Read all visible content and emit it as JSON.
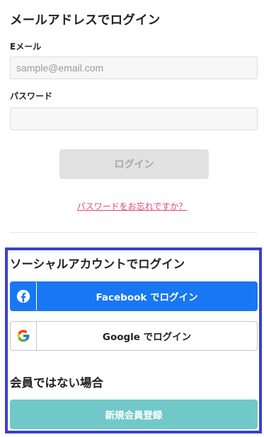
{
  "email_login": {
    "heading": "メールアドレスでログイン",
    "email_label": "Eメール",
    "email_placeholder": "sample@email.com",
    "email_value": "",
    "password_label": "パスワード",
    "password_value": "",
    "login_button": "ログイン",
    "forgot_link": "パスワードをお忘れですか？"
  },
  "social_login": {
    "heading": "ソーシャルアカウントでログイン",
    "facebook_button": "Facebook でログイン",
    "google_button": "Google でログイン",
    "facebook_icon": "facebook-icon",
    "google_icon": "google-icon"
  },
  "register": {
    "heading": "会員ではない場合",
    "button": "新規会員登録"
  },
  "colors": {
    "facebook_blue": "#1877f2",
    "register_teal": "#70c9c8",
    "link_pink": "#e0457b",
    "highlight_border": "#3a3fd0"
  }
}
